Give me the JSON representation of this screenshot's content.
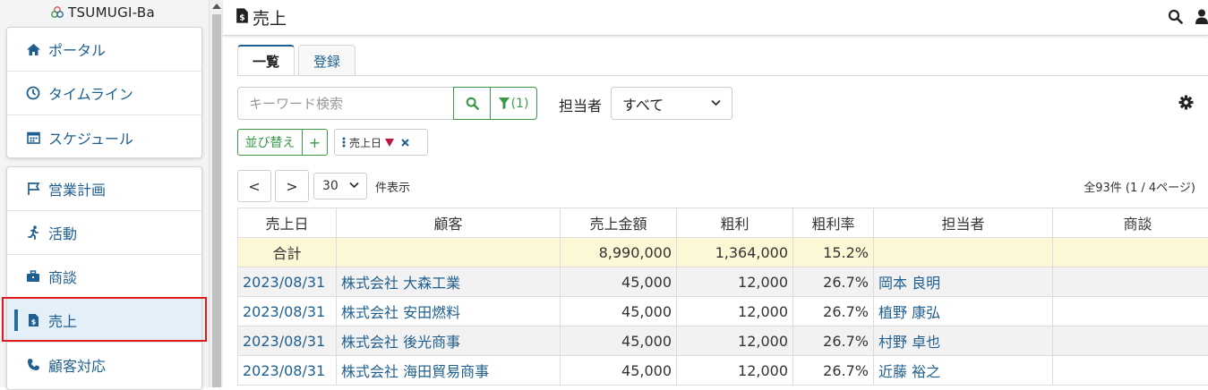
{
  "app": {
    "logo_text": "TSUMUGI-Ba"
  },
  "sidebar": {
    "group1": [
      {
        "label": "ポータル",
        "icon": "home-icon"
      },
      {
        "label": "タイムライン",
        "icon": "clock-icon"
      },
      {
        "label": "スケジュール",
        "icon": "calendar-icon"
      }
    ],
    "group2": [
      {
        "label": "営業計画",
        "icon": "flag-icon"
      },
      {
        "label": "活動",
        "icon": "running-icon"
      },
      {
        "label": "商談",
        "icon": "briefcase-icon"
      },
      {
        "label": "売上",
        "icon": "invoice-icon",
        "active": true
      },
      {
        "label": "顧客対応",
        "icon": "phone-icon"
      }
    ]
  },
  "header": {
    "title": "売上"
  },
  "tabs": [
    {
      "label": "一覧",
      "active": true
    },
    {
      "label": "登録"
    }
  ],
  "filters": {
    "search_placeholder": "キーワード検索",
    "filter_count": "(1)",
    "assignee_label": "担当者",
    "assignee_value": "すべて",
    "sort_label": "並び替え",
    "add_label": "+",
    "sort_chip_label": "売上日"
  },
  "pager": {
    "prev": "<",
    "next": ">",
    "per_page": "30",
    "per_page_label": "件表示",
    "total": "全93件 (1 / 4ページ)"
  },
  "table": {
    "columns": [
      "売上日",
      "顧客",
      "売上金額",
      "粗利",
      "粗利率",
      "担当者",
      "商談"
    ],
    "summary": {
      "label": "合計",
      "amount": "8,990,000",
      "profit": "1,364,000",
      "rate": "15.2%"
    },
    "rows": [
      {
        "date": "2023/08/31",
        "customer": "株式会社 大森工業",
        "amount": "45,000",
        "profit": "12,000",
        "rate": "26.7%",
        "person": "岡本 良明",
        "deal": ""
      },
      {
        "date": "2023/08/31",
        "customer": "株式会社 安田燃料",
        "amount": "45,000",
        "profit": "12,000",
        "rate": "26.7%",
        "person": "植野 康弘",
        "deal": ""
      },
      {
        "date": "2023/08/31",
        "customer": "株式会社 後光商事",
        "amount": "45,000",
        "profit": "12,000",
        "rate": "26.7%",
        "person": "村野 卓也",
        "deal": ""
      },
      {
        "date": "2023/08/31",
        "customer": "株式会社 海田貿易商事",
        "amount": "45,000",
        "profit": "12,000",
        "rate": "26.7%",
        "person": "近藤 裕之",
        "deal": ""
      }
    ]
  },
  "colors": {
    "accent": "#1f5f8f",
    "green": "#3a9a48",
    "highlight_red": "#e01b1b",
    "summary_bg": "#fcf7d4"
  }
}
